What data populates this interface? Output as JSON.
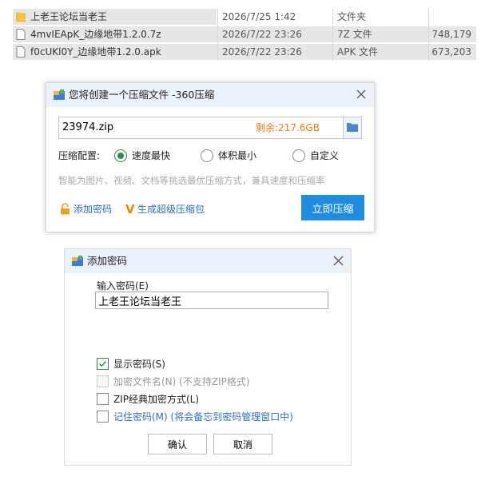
{
  "file_list": {
    "rows": [
      {
        "name": "上老王论坛当老王",
        "date": "2026/7/25 1:42",
        "type": "文件夹",
        "size": "",
        "icon": "folder-icon"
      },
      {
        "name": "4mvIEApK_边缘地带1.2.0.7z",
        "date": "2026/7/22 23:26",
        "type": "7Z 文件",
        "size": "748,179",
        "icon": "file-icon"
      },
      {
        "name": "f0cUKl0Y_边缘地带1.2.0.apk",
        "date": "2026/7/22 23:26",
        "type": "APK 文件",
        "size": "673,203",
        "icon": "file-icon"
      }
    ]
  },
  "compress_dialog": {
    "title": "您将创建一个压缩文件 -360压缩",
    "filename": "23974.zip",
    "remaining": "剩余:217.6GB",
    "config_label": "压缩配置:",
    "options": [
      {
        "label": "速度最快",
        "checked": true
      },
      {
        "label": "体积最小",
        "checked": false
      },
      {
        "label": "自定义",
        "checked": false
      }
    ],
    "hint": "智能为图片、视频、文档等挑选最优压缩方式，兼具速度和压缩率",
    "add_password": "添加密码",
    "super_mark": "V",
    "super_package": "生成超级压缩包",
    "compress_button": "立即压缩",
    "accent_color": "#1e8de0",
    "remaining_color": "#f07a16"
  },
  "password_dialog": {
    "title": "添加密码",
    "input_label": "输入密码(E)",
    "password_value": "上老王论坛当老王",
    "checkboxes": [
      {
        "label": "显示密码(S)",
        "checked": true,
        "disabled": false
      },
      {
        "label": "加密文件名(N) (不支持ZIP格式)",
        "checked": false,
        "disabled": true
      },
      {
        "label": "ZIP经典加密方式(L)",
        "checked": false,
        "disabled": false
      },
      {
        "label": "记住密码(M) (将会备忘到密码管理窗口中)",
        "checked": false,
        "disabled": false
      }
    ],
    "ok_button": "确认",
    "cancel_button": "取消"
  }
}
